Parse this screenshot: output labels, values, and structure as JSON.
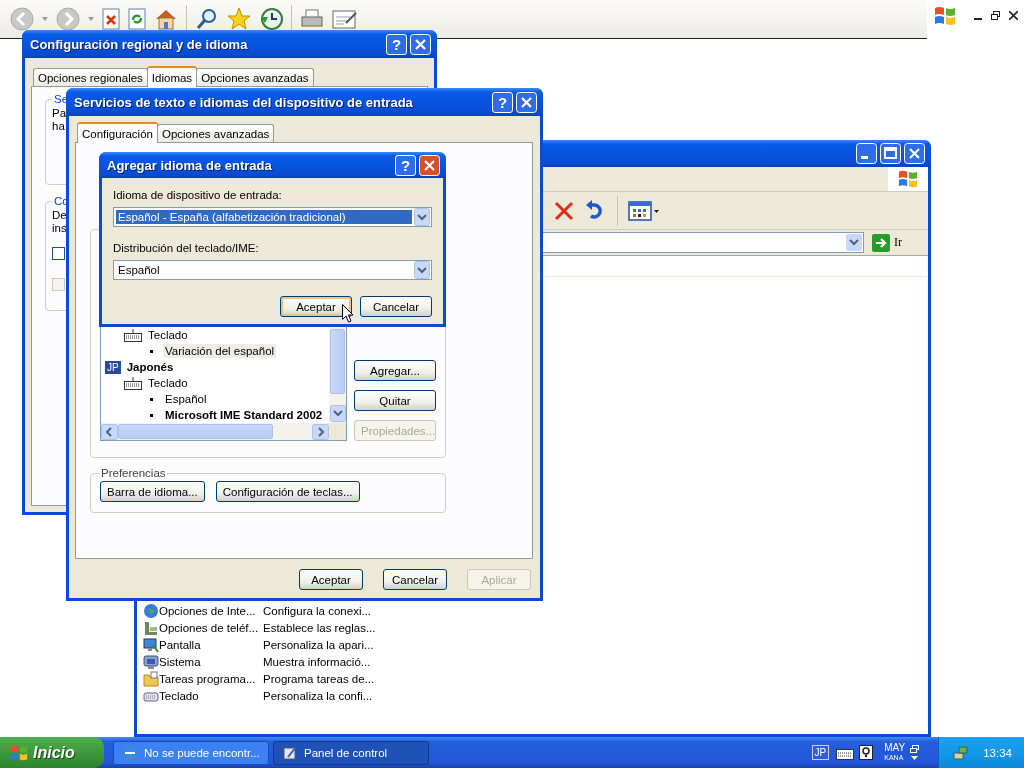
{
  "control_panel": {
    "go_label": "Ir",
    "items": [
      {
        "kind": "globe",
        "name": "Opciones de Inte...",
        "description": "Configura la conexi..."
      },
      {
        "kind": "phone",
        "name": "Opciones de teléf...",
        "description": "Establece las reglas..."
      },
      {
        "kind": "display",
        "name": "Pantalla",
        "description": "Personaliza la apari..."
      },
      {
        "kind": "computer",
        "name": "Sistema",
        "description": "Muestra informació..."
      },
      {
        "kind": "folder",
        "name": "Tareas programa...",
        "description": "Programa tareas de..."
      },
      {
        "kind": "keyboard",
        "name": "Teclado",
        "description": "Personaliza la confi..."
      }
    ]
  },
  "regional_dialog": {
    "title": "Configuración regional y de idioma",
    "help_button": "?",
    "tabs": [
      {
        "label": "Opciones regionales",
        "selected": false
      },
      {
        "label": "Idiomas",
        "selected": true
      },
      {
        "label": "Opciones avanzadas",
        "selected": false
      }
    ],
    "group_1": {
      "label": "Se",
      "text": [
        "Pa",
        "ha"
      ]
    },
    "group_2": {
      "label": "Co",
      "text": [
        "De",
        "ins"
      ],
      "checkboxes": [
        {
          "checked": false,
          "disabled": false
        },
        {
          "checked": false,
          "disabled": true
        }
      ]
    }
  },
  "text_services_dialog": {
    "title": "Servicios de texto e idiomas del dispositivo de entrada",
    "help_button": "?",
    "tabs": [
      {
        "label": "Configuración",
        "selected": true
      },
      {
        "label": "Opciones avanzadas",
        "selected": false
      }
    ],
    "installed_services": [
      {
        "kind": "device",
        "label": "Teclado",
        "children": [
          {
            "kind": "layout",
            "label": "Variación del español",
            "selected": true,
            "default": false
          }
        ]
      },
      {
        "kind": "language",
        "badge": "JP",
        "label": "Japonés",
        "children": [
          {
            "kind": "device",
            "label": "Teclado",
            "children": [
              {
                "kind": "layout",
                "label": "Español",
                "selected": false,
                "default": false
              },
              {
                "kind": "layout",
                "label": "Microsoft IME Standard 2002",
                "selected": false,
                "default": true
              }
            ]
          }
        ]
      }
    ],
    "side_buttons": [
      {
        "label": "Agregar...",
        "disabled": false
      },
      {
        "label": "Quitar",
        "disabled": false
      },
      {
        "label": "Propiedades...",
        "disabled": true
      }
    ],
    "preferences": {
      "title": "Preferencias",
      "buttons": [
        "Barra de idioma...",
        "Configuración de teclas..."
      ]
    },
    "footer_buttons": [
      {
        "label": "Aceptar",
        "disabled": false
      },
      {
        "label": "Cancelar",
        "disabled": false
      },
      {
        "label": "Aplicar",
        "disabled": true
      }
    ]
  },
  "add_language_dialog": {
    "title": "Agregar idioma de entrada",
    "help_button": "?",
    "fields": [
      {
        "label": "Idioma de dispositivo de entrada:",
        "value": "Español - España (alfabetización tradicional)",
        "focused": true
      },
      {
        "label": "Distribución del teclado/IME:",
        "value": "Español",
        "focused": false
      }
    ],
    "buttons": [
      {
        "label": "Aceptar",
        "default": true
      },
      {
        "label": "Cancelar",
        "default": false
      }
    ]
  },
  "taskbar": {
    "start": "Inicio",
    "tasks": [
      {
        "label": "No se puede encontr...",
        "selected": false
      },
      {
        "label": "Panel de control",
        "selected": true
      }
    ],
    "tray": {
      "language": "JP",
      "caps": "MAY",
      "mode": "KANA",
      "clock": "13:34"
    }
  }
}
